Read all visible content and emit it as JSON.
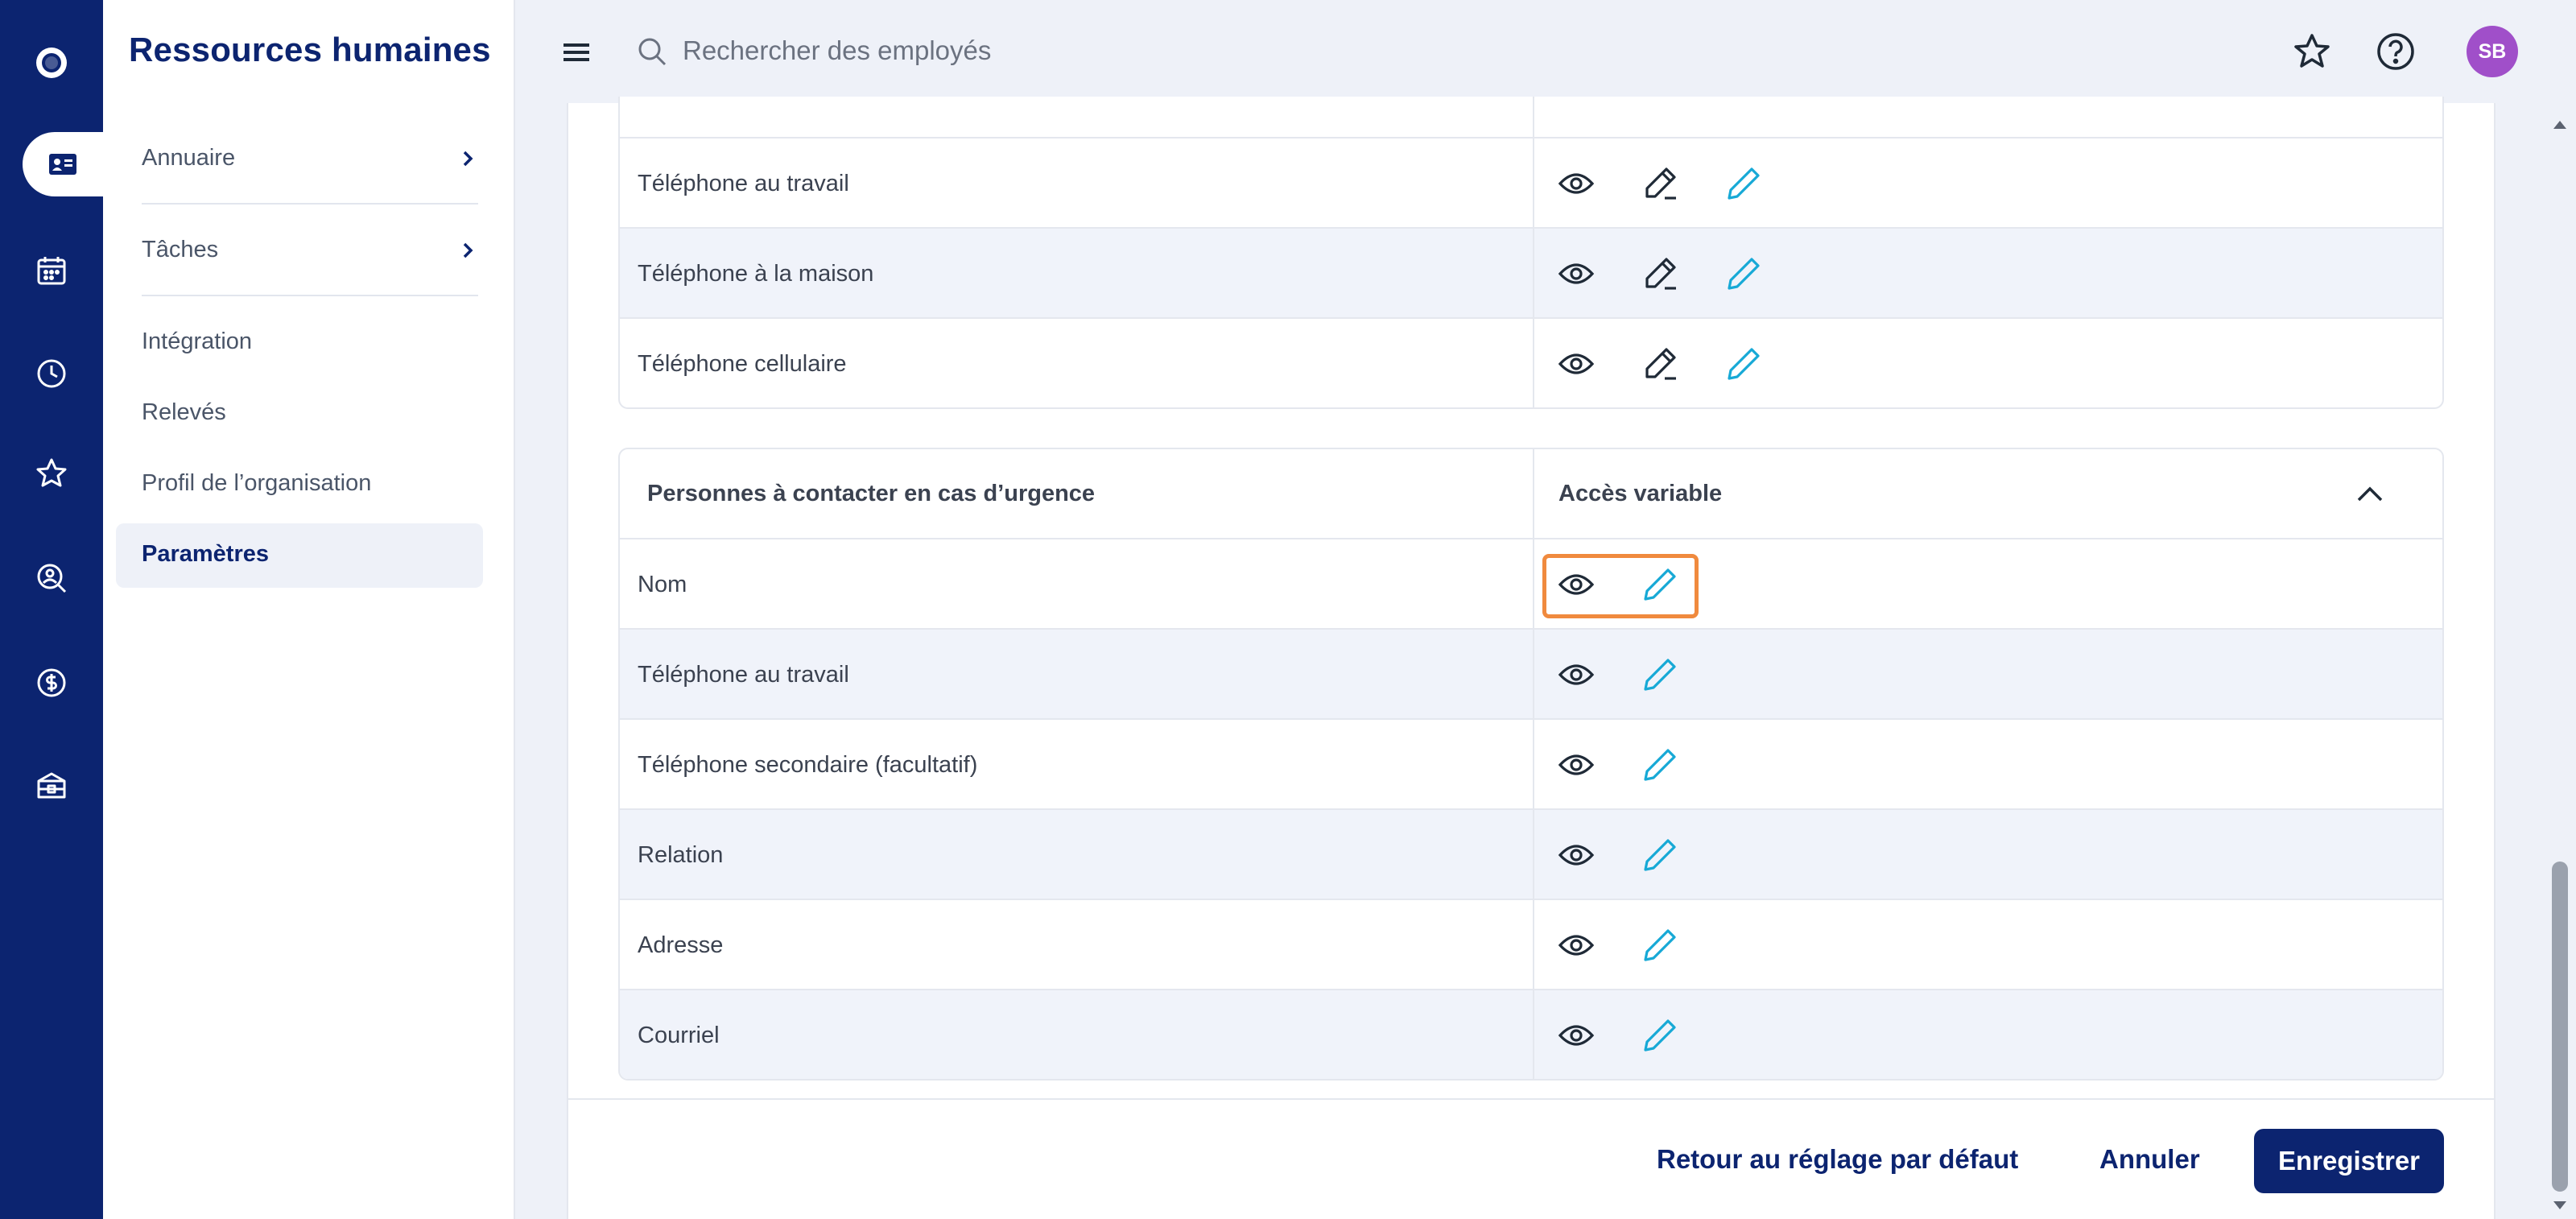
{
  "app": {
    "title": "Ressources humaines"
  },
  "rail": {
    "icons": [
      "logo-icon",
      "contact-card-icon",
      "calendar-icon",
      "clock-icon",
      "star-icon",
      "person-search-icon",
      "dollar-icon",
      "box-icon"
    ],
    "active": "contact-card-icon"
  },
  "sidebar": {
    "items": [
      {
        "label": "Annuaire",
        "has_chevron": true
      },
      {
        "label": "Tâches",
        "has_chevron": true
      },
      {
        "label": "Intégration"
      },
      {
        "label": "Relevés"
      },
      {
        "label": "Profil de l’organisation"
      },
      {
        "label": "Paramètres",
        "active": true
      }
    ]
  },
  "topbar": {
    "search_placeholder": "Rechercher des employés",
    "avatar_initials": "SB"
  },
  "phones_section": {
    "rows": [
      {
        "label": "Téléphone au travail"
      },
      {
        "label": "Téléphone à la maison"
      },
      {
        "label": "Téléphone cellulaire"
      }
    ]
  },
  "emergency_section": {
    "title": "Personnes à contacter en cas d’urgence",
    "access_label": "Accès variable",
    "rows": [
      {
        "label": "Nom"
      },
      {
        "label": "Téléphone au travail"
      },
      {
        "label": "Téléphone secondaire (facultatif)"
      },
      {
        "label": "Relation"
      },
      {
        "label": "Adresse"
      },
      {
        "label": "Courriel"
      }
    ]
  },
  "footer": {
    "reset_label": "Retour au réglage par défaut",
    "cancel_label": "Annuler",
    "save_label": "Enregistrer"
  },
  "colors": {
    "brand": "#0c2470",
    "accent_edit": "#17a9d6",
    "highlight": "#f08a3e",
    "avatar": "#a04fc9"
  }
}
